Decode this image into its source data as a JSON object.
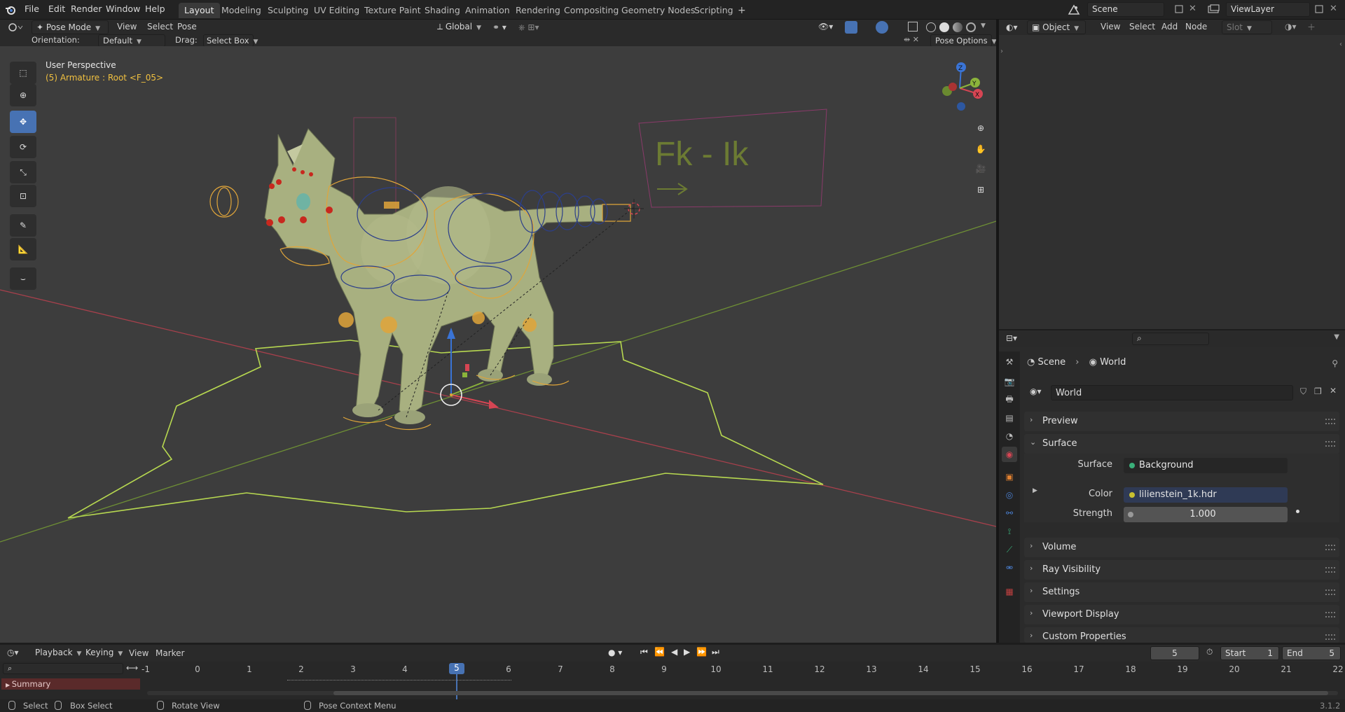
{
  "topbar": {
    "menus": [
      "File",
      "Edit",
      "Render",
      "Window",
      "Help"
    ],
    "workspaces": [
      "Layout",
      "Modeling",
      "Sculpting",
      "UV Editing",
      "Texture Paint",
      "Shading",
      "Animation",
      "Rendering",
      "Compositing",
      "Geometry Nodes",
      "Scripting"
    ],
    "active_workspace": "Layout",
    "add_tab": "+",
    "scene": "Scene",
    "view_layer": "ViewLayer"
  },
  "viewport_header": {
    "mode": "Pose Mode",
    "menus": [
      "View",
      "Select",
      "Pose"
    ],
    "transform_orientation": "Global",
    "orientation_label": "Orientation:",
    "orientation_value": "Default",
    "drag_label": "Drag:",
    "drag_value": "Select Box",
    "pose_options": "Pose Options"
  },
  "viewport": {
    "view_name": "User Perspective",
    "active_object": "(5) Armature : Root <F_05>",
    "gizmo_axes": {
      "x": "X",
      "y": "Y",
      "z": "Z"
    },
    "fk_ik_text": "Fk  -  Ik",
    "tools": [
      "select-box",
      "cursor",
      "move",
      "rotate",
      "scale",
      "transform",
      "annotate",
      "measure",
      "bone-envelope"
    ],
    "active_tool": "move"
  },
  "node_editor_header": {
    "type": "Object",
    "menus": [
      "View",
      "Select",
      "Add",
      "Node"
    ],
    "slot": "Slot"
  },
  "properties": {
    "search_placeholder": "",
    "breadcrumb": [
      "Scene",
      "World"
    ],
    "world_name": "World",
    "panels": {
      "preview": "Preview",
      "surface": "Surface",
      "volume": "Volume",
      "ray_visibility": "Ray Visibility",
      "settings": "Settings",
      "viewport_display": "Viewport Display",
      "custom_properties": "Custom Properties"
    },
    "surface_label": "Surface",
    "surface_value": "Background",
    "color_label": "Color",
    "color_value": "lilienstein_1k.hdr",
    "strength_label": "Strength",
    "strength_value": "1.000"
  },
  "timeline": {
    "menus": [
      "Playback",
      "Keying",
      "View",
      "Marker"
    ],
    "current_frame": "5",
    "start_label": "Start",
    "start_value": "1",
    "end_label": "End",
    "end_value": "5",
    "frames": [
      "-1",
      "0",
      "1",
      "2",
      "3",
      "4",
      "5",
      "6",
      "7",
      "8",
      "9",
      "10",
      "11",
      "12",
      "13",
      "14",
      "15",
      "16",
      "17",
      "18",
      "19",
      "20",
      "21",
      "22"
    ],
    "summary": "Summary"
  },
  "statusbar": {
    "select": "Select",
    "box_select": "Box Select",
    "rotate_view": "Rotate View",
    "context_menu": "Pose Context Menu",
    "version": "3.1.2"
  },
  "colors": {
    "accent": "#4772b3",
    "x_axis": "#d64553",
    "y_axis": "#8bb33b",
    "z_axis": "#3a74d6",
    "bone_orange": "#e0a53a",
    "ground_outline": "#b7d850"
  }
}
